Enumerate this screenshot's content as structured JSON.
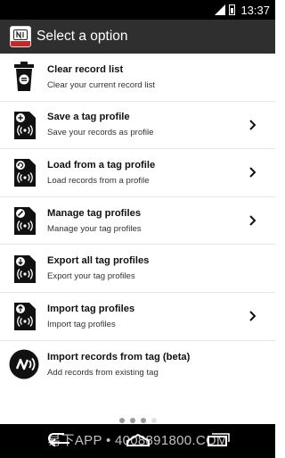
{
  "status_bar": {
    "time": "13:37"
  },
  "action_bar": {
    "title": "Select a option"
  },
  "items": [
    {
      "icon": "trash-icon",
      "title": "Clear record list",
      "subtitle": "Clear your current record list",
      "has_chevron": false
    },
    {
      "icon": "save-tag-profile-icon",
      "title": "Save a tag profile",
      "subtitle": "Save your records as profile",
      "has_chevron": true
    },
    {
      "icon": "load-tag-profile-icon",
      "title": "Load from a tag profile",
      "subtitle": "Load records from a profile",
      "has_chevron": true
    },
    {
      "icon": "manage-tag-profile-icon",
      "title": "Manage tag profiles",
      "subtitle": "Manage your tag profiles",
      "has_chevron": true
    },
    {
      "icon": "export-tag-profile-icon",
      "title": "Export all tag profiles",
      "subtitle": "Export your tag profiles",
      "has_chevron": false
    },
    {
      "icon": "import-tag-profile-icon",
      "title": "Import tag profiles",
      "subtitle": "Import tag profiles",
      "has_chevron": true
    },
    {
      "icon": "nfc-tag-icon",
      "title": "Import records from tag (beta)",
      "subtitle": "Add records from existing tag",
      "has_chevron": false
    }
  ],
  "watermark": "易下APP • 4008891800.COM",
  "colors": {
    "action_bar": "#2f2f2f",
    "status_bar": "#000000",
    "app_logo_strip": "#c62828"
  }
}
